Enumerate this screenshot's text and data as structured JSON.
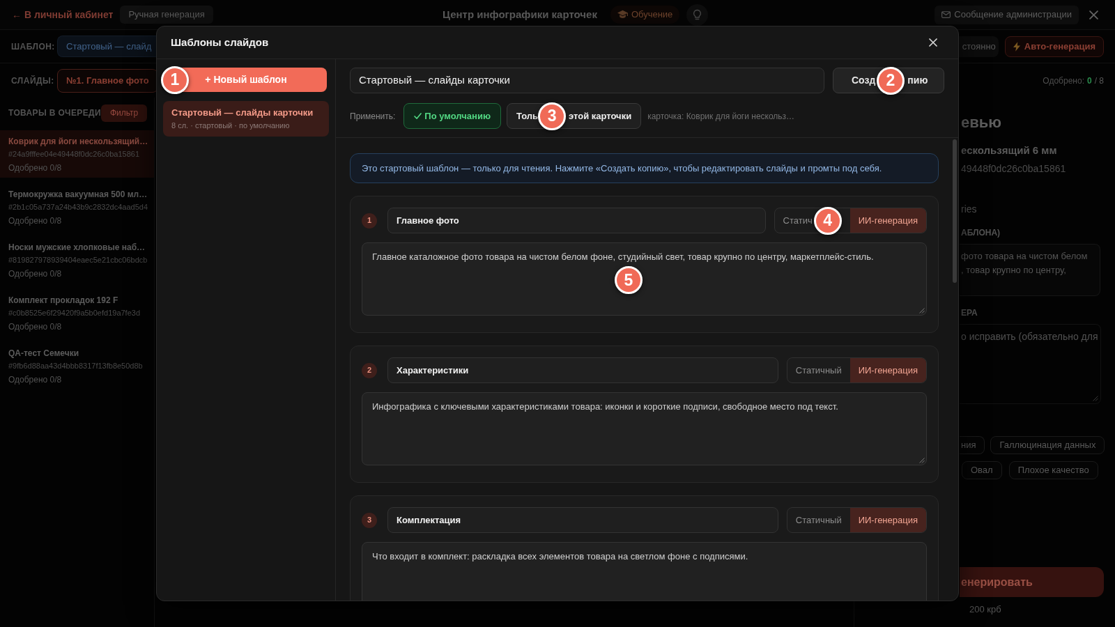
{
  "app_bar": {
    "back_link": "← В личный кабинет",
    "mode_chip": "Ручная генерация",
    "title": "Центр инфографики карточек",
    "tutorial_button": "Обучение",
    "message_button": "Сообщение администрации"
  },
  "template_bar": {
    "label": "ШАБЛОН:",
    "template_chip": "Стартовый — слайд",
    "save_mode_button": "стоянно",
    "auto_button": "Авто-генерация"
  },
  "slides_bar": {
    "label": "СЛАЙДЫ:",
    "slide_chips": [
      {
        "label": "№1. Главное фото",
        "selected": true
      }
    ],
    "approved": {
      "label": "Одобрено:",
      "count": "0",
      "total": "/ 8"
    }
  },
  "queue": {
    "title": "ТОВАРЫ В ОЧЕРЕДИ",
    "filter_button": "Фильтр",
    "items": [
      {
        "name": "Коврик для йоги нескользящий…",
        "hash": "#24a9fffee04e49448f0dc26c0ba15861",
        "approved": "Одобрено 0/8",
        "selected": true
      },
      {
        "name": "Термокружка вакуумная 500 мл…",
        "hash": "#2b1c05a737a24b43b9c2832dc4aad5d4",
        "approved": "Одобрено 0/8",
        "selected": false
      },
      {
        "name": "Носки мужские хлопковые наб…",
        "hash": "#819827978939404eaec5e21cbc06bdcb",
        "approved": "Одобрено 0/8",
        "selected": false
      },
      {
        "name": "Комплект прокладок 192 F",
        "hash": "#c0b8525e6f29420f9a5b0efd19a7fe3d",
        "approved": "Одобрено 0/8",
        "selected": false
      },
      {
        "name": "QA-тест Семечки",
        "hash": "#9fb6d88aa43d4bbb8317f13fb8e50d8b",
        "approved": "Одобрено 0/8",
        "selected": false
      }
    ]
  },
  "preview": {
    "heading": "евью",
    "product_name": "ескользящий 6 мм",
    "product_hash": "49448f0dc26c0ba15861",
    "category": "ries",
    "template_prompt_label": "АБЛОНА)",
    "template_prompt_lines": [
      "фото товара на чистом белом",
      ", товар крупно по центру,"
    ],
    "reviewer_label": "ЕРА",
    "reviewer_note": {
      "placeholder": "о исправить (обязательно для"
    },
    "tag_rows": [
      [
        "ния",
        "Галлюцинация данных"
      ],
      [
        "Овал",
        "Плохое качество"
      ]
    ],
    "generate_button": "енерировать",
    "price": "200 крб"
  },
  "modal": {
    "title": "Шаблоны слайдов",
    "new_template_button": {
      "label": "+ Новый шаблон",
      "callout": "1"
    },
    "templates": [
      {
        "name": "Стартовый — слайды карточки",
        "meta": "8 сл. · стартовый · по умолчанию",
        "selected": true
      }
    ],
    "template_name": "Стартовый — слайды карточки",
    "copy_button": {
      "visible_parts": [
        "Созд",
        "пию"
      ],
      "callout": "2"
    },
    "apply_label": "Применить:",
    "scopes": [
      {
        "visible_parts": [
          "По умолчанию"
        ],
        "selected": true
      },
      {
        "visible_parts": [
          "Толь",
          "этой карточки"
        ],
        "selected": false,
        "callout": "3"
      }
    ],
    "card_hint": "карточка: Коврик для йоги нескольз…",
    "notice": "Это стартовый шаблон — только для чтения. Нажмите «Создать копию», чтобы редактировать слайды и промты под себя.",
    "slides": [
      {
        "number": "1",
        "title": "Главное фото",
        "mode_toggle": {
          "callout": "4",
          "options": [
            {
              "label": "Статич",
              "selected": false
            },
            {
              "label": "ИИ-генерация",
              "selected": true
            }
          ]
        },
        "prompt": {
          "text": "Главное каталожное фото товара на чистом белом фоне, студийный свет, товар крупно по центру, маркетплейс-стиль.",
          "callout": "5"
        }
      },
      {
        "number": "2",
        "title": "Характеристики",
        "mode_toggle": {
          "options": [
            {
              "label": "Статичный",
              "selected": false
            },
            {
              "label": "ИИ-генерация",
              "selected": true
            }
          ]
        },
        "prompt": {
          "text": "Инфографика с ключевыми характеристиками товара: иконки и короткие подписи, свободное место под текст."
        }
      },
      {
        "number": "3",
        "title": "Комплектация",
        "mode_toggle": {
          "options": [
            {
              "label": "Статичный",
              "selected": false
            },
            {
              "label": "ИИ-генерация",
              "selected": true
            }
          ]
        },
        "prompt": {
          "text": "Что входит в комплект: раскладка всех элементов товара на светлом фоне с подписями."
        }
      }
    ]
  }
}
